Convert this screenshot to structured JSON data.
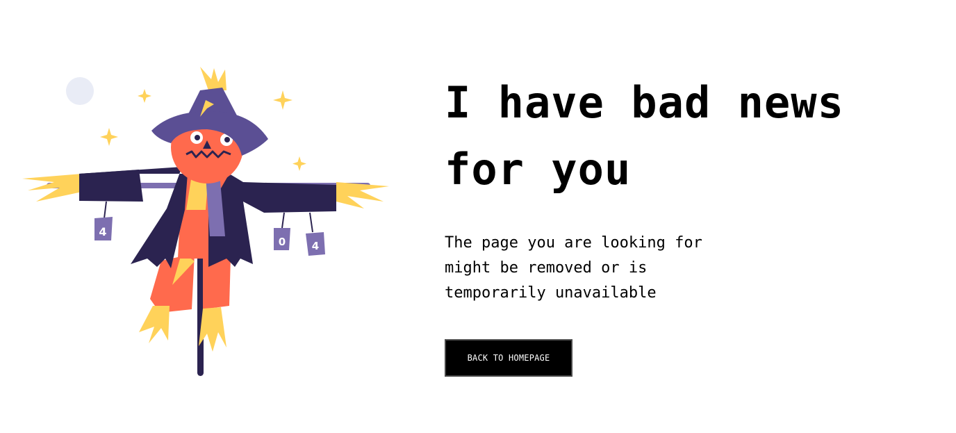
{
  "headline": "I have bad news for you",
  "description": "The page you are looking for might be removed or is temporarily unavailable",
  "back_button_label": "BACK TO HOMEPAGE",
  "illustration": {
    "can_labels": [
      "4",
      "0",
      "4"
    ]
  },
  "colors": {
    "text": "#000000",
    "button_bg": "#000000",
    "button_text": "#ffffff",
    "hat": "#5b4f94",
    "coat": "#2b2350",
    "face": "#ff6a4d",
    "straw": "#ffd25a",
    "can": "#7d6fb0",
    "moon": "#e9ecf6"
  }
}
